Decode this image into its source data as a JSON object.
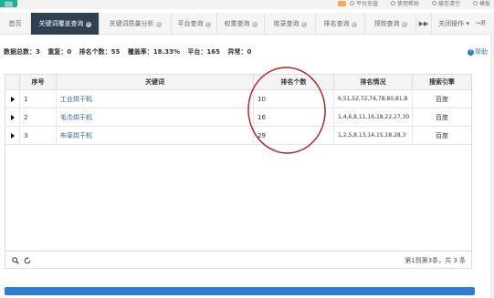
{
  "topbar": {
    "tools": [
      "平台充值",
      "使用帮助",
      "缓存清空",
      "模板"
    ]
  },
  "tabs": {
    "items": [
      {
        "label": "首页",
        "closable": false,
        "active": false
      },
      {
        "label": "关键词覆盖查询",
        "closable": true,
        "active": true
      },
      {
        "label": "关键词质量分析",
        "closable": true,
        "active": false
      },
      {
        "label": "平台查询",
        "closable": true,
        "active": false
      },
      {
        "label": "权重查询",
        "closable": true,
        "active": false
      },
      {
        "label": "收录查询",
        "closable": true,
        "active": false
      },
      {
        "label": "排名查询",
        "closable": true,
        "active": false
      },
      {
        "label": "领效查询",
        "closable": true,
        "active": false
      }
    ],
    "more_arrow": "▶▶",
    "close_ops": "关闭操作 ▾",
    "exit": "退"
  },
  "stats": {
    "total_label": "数据总数：",
    "total": "3",
    "dup_label": "重复：",
    "dup": "0",
    "rank_label": "排名个数：",
    "rank": "55",
    "cover_label": "覆盖率：",
    "cover": "18.33%",
    "platform_label": "平台：",
    "platform": "165",
    "error_label": "异常：",
    "error": "0"
  },
  "help": "帮助",
  "table": {
    "headers": {
      "index": "序号",
      "keyword": "关键词",
      "rank_count": "排名个数",
      "rank_detail": "排名情况",
      "engine": "搜索引擎"
    },
    "rows": [
      {
        "index": "1",
        "keyword": "工业烘干机",
        "rank_count": "10",
        "rank_detail": "6,51,52,72,74,78,80,81,8",
        "engine": "百度"
      },
      {
        "index": "2",
        "keyword": "毛巾烘干机",
        "rank_count": "16",
        "rank_detail": "1,4,6,8,11,16,18,22,27,30",
        "engine": "百度"
      },
      {
        "index": "3",
        "keyword": "布草烘干机",
        "rank_count": "29",
        "rank_detail": "1,2,5,8,13,14,15,18,28,3",
        "engine": "百度"
      }
    ]
  },
  "pagination": "第1到第3条，共 3 条",
  "colors": {
    "active_tab": "#2f4050",
    "accent_green": "#1ab394",
    "annotation_circle": "#b0282c",
    "bottom_bar": "#2d7cd6"
  }
}
